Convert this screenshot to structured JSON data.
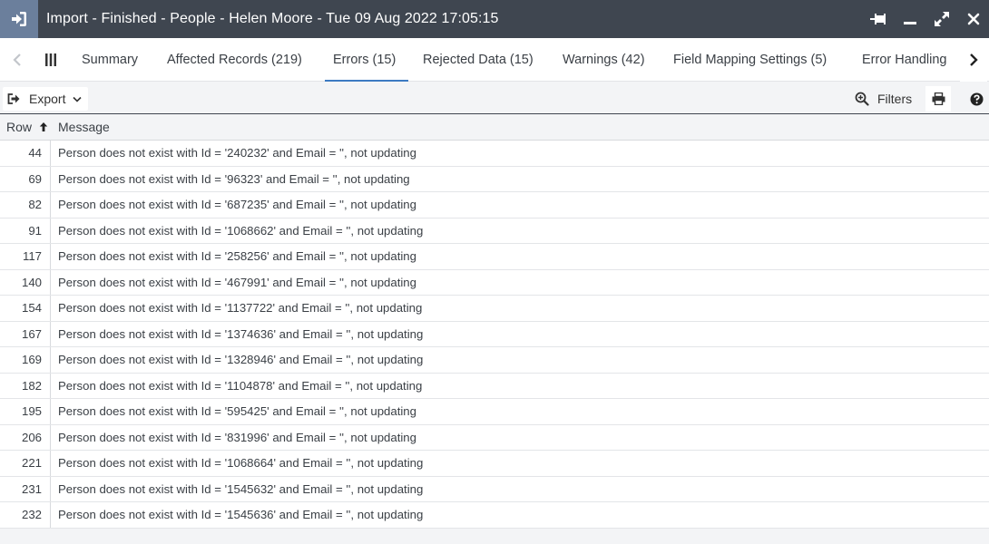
{
  "window": {
    "title": "Import - Finished - People - Helen Moore - Tue 09 Aug 2022 17:05:15",
    "icons": [
      "sign-in-icon",
      "pin-icon",
      "minimize-icon",
      "expand-icon",
      "close-icon"
    ]
  },
  "tabs": [
    {
      "label": "Summary"
    },
    {
      "label": "Affected Records (219)"
    },
    {
      "label": "Errors (15)",
      "active": true
    },
    {
      "label": "Rejected Data (15)"
    },
    {
      "label": "Warnings (42)"
    },
    {
      "label": "Field Mapping Settings (5)"
    },
    {
      "label": "Error Handling"
    }
  ],
  "toolbar": {
    "export_label": "Export",
    "filters_label": "Filters"
  },
  "grid": {
    "columns": [
      "Row",
      "Message"
    ],
    "sort_column": "Row",
    "rows": [
      {
        "row": "44",
        "message": "Person does not exist with Id = '240232' and Email = '', not updating"
      },
      {
        "row": "69",
        "message": "Person does not exist with Id = '96323' and Email = '', not updating"
      },
      {
        "row": "82",
        "message": "Person does not exist with Id = '687235' and Email = '', not updating"
      },
      {
        "row": "91",
        "message": "Person does not exist with Id = '1068662' and Email = '', not updating"
      },
      {
        "row": "117",
        "message": "Person does not exist with Id = '258256' and Email = '', not updating"
      },
      {
        "row": "140",
        "message": "Person does not exist with Id = '467991' and Email = '', not updating"
      },
      {
        "row": "154",
        "message": "Person does not exist with Id = '1137722' and Email = '', not updating"
      },
      {
        "row": "167",
        "message": "Person does not exist with Id = '1374636' and Email = '', not updating"
      },
      {
        "row": "169",
        "message": "Person does not exist with Id = '1328946' and Email = '', not updating"
      },
      {
        "row": "182",
        "message": "Person does not exist with Id = '1104878' and Email = '', not updating"
      },
      {
        "row": "195",
        "message": "Person does not exist with Id = '595425' and Email = '', not updating"
      },
      {
        "row": "206",
        "message": "Person does not exist with Id = '831996' and Email = '', not updating"
      },
      {
        "row": "221",
        "message": "Person does not exist with Id = '1068664' and Email = '', not updating"
      },
      {
        "row": "231",
        "message": "Person does not exist with Id = '1545632' and Email = '', not updating"
      },
      {
        "row": "232",
        "message": "Person does not exist with Id = '1545636' and Email = '', not updating"
      }
    ]
  },
  "colors": {
    "titlebar": "#3f4650",
    "title_icon_bg": "#6b7f9c",
    "active_tab_underline": "#3c7ac2"
  }
}
